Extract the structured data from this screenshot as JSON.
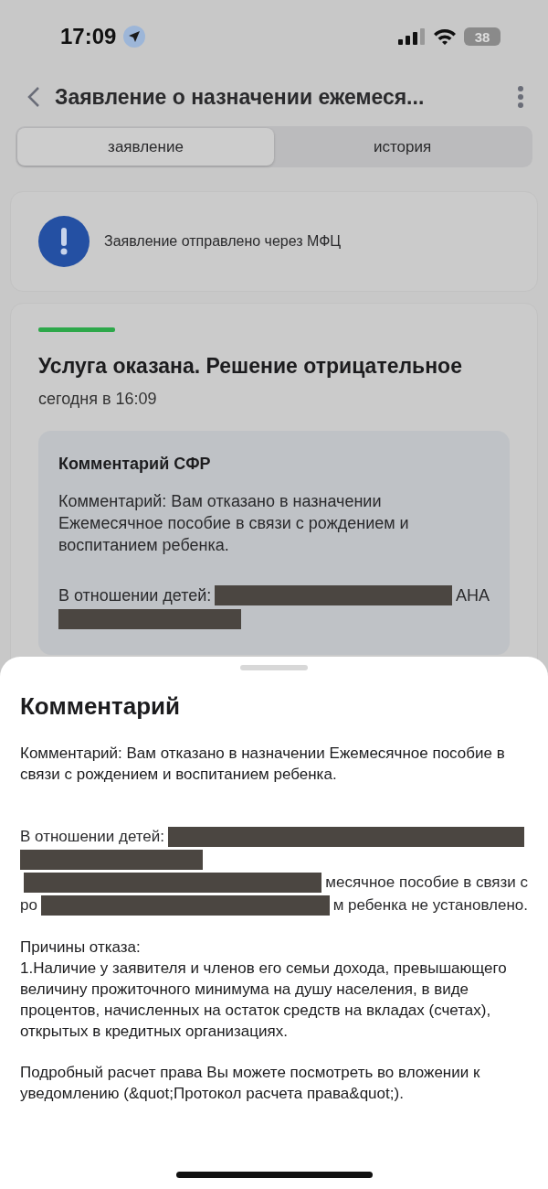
{
  "status_bar": {
    "time": "17:09",
    "battery": "38"
  },
  "header": {
    "title": "Заявление о назначении ежемеся..."
  },
  "tabs": [
    {
      "label": "заявление",
      "selected": true
    },
    {
      "label": "история",
      "selected": false
    }
  ],
  "notice": {
    "text": "Заявление отправлено через МФЦ"
  },
  "status_card": {
    "title": "Услуга оказана. Решение отрицательное",
    "time": "сегодня в 16:09",
    "comment": {
      "title": "Комментарий СФР",
      "text": "Комментарий: Вам отказано в назначении Ежемесячное пособие в связи с рождением и воспитанием ребенка.",
      "lines": [
        [
          {
            "kind": "text",
            "text": "В отношении детей:"
          },
          {
            "kind": "redacted"
          },
          {
            "kind": "text",
            "text": "АНА"
          }
        ],
        [
          {
            "kind": "redacted"
          }
        ]
      ]
    }
  },
  "sheet": {
    "title": "Комментарий",
    "intro": "Комментарий: Вам отказано в назначении Ежемесячное пособие в связи с рождением и воспитанием ребенка.",
    "lines": [
      [
        {
          "kind": "text",
          "text": "В отношении детей:"
        },
        {
          "kind": "redacted"
        }
      ],
      [
        {
          "kind": "redacted"
        }
      ],
      [
        {
          "kind": "redacted"
        },
        {
          "kind": "text",
          "text": "месячное пособие в связи с"
        }
      ],
      [
        {
          "kind": "text",
          "text": "ро"
        },
        {
          "kind": "redacted"
        },
        {
          "kind": "text",
          "text": "м ребенка не установлено."
        }
      ]
    ],
    "reasons": "Причины отказа:\n1.Наличие у заявителя и членов его семьи дохода, превышающего величину прожиточного минимума на душу населения, в виде процентов, начисленных на остаток средств на вкладах (счетах), открытых в кредитных организациях.",
    "footer": "Подробный расчет права Вы можете посмотреть во вложении к уведомлению (&quot;Протокол расчета права&quot;)."
  }
}
